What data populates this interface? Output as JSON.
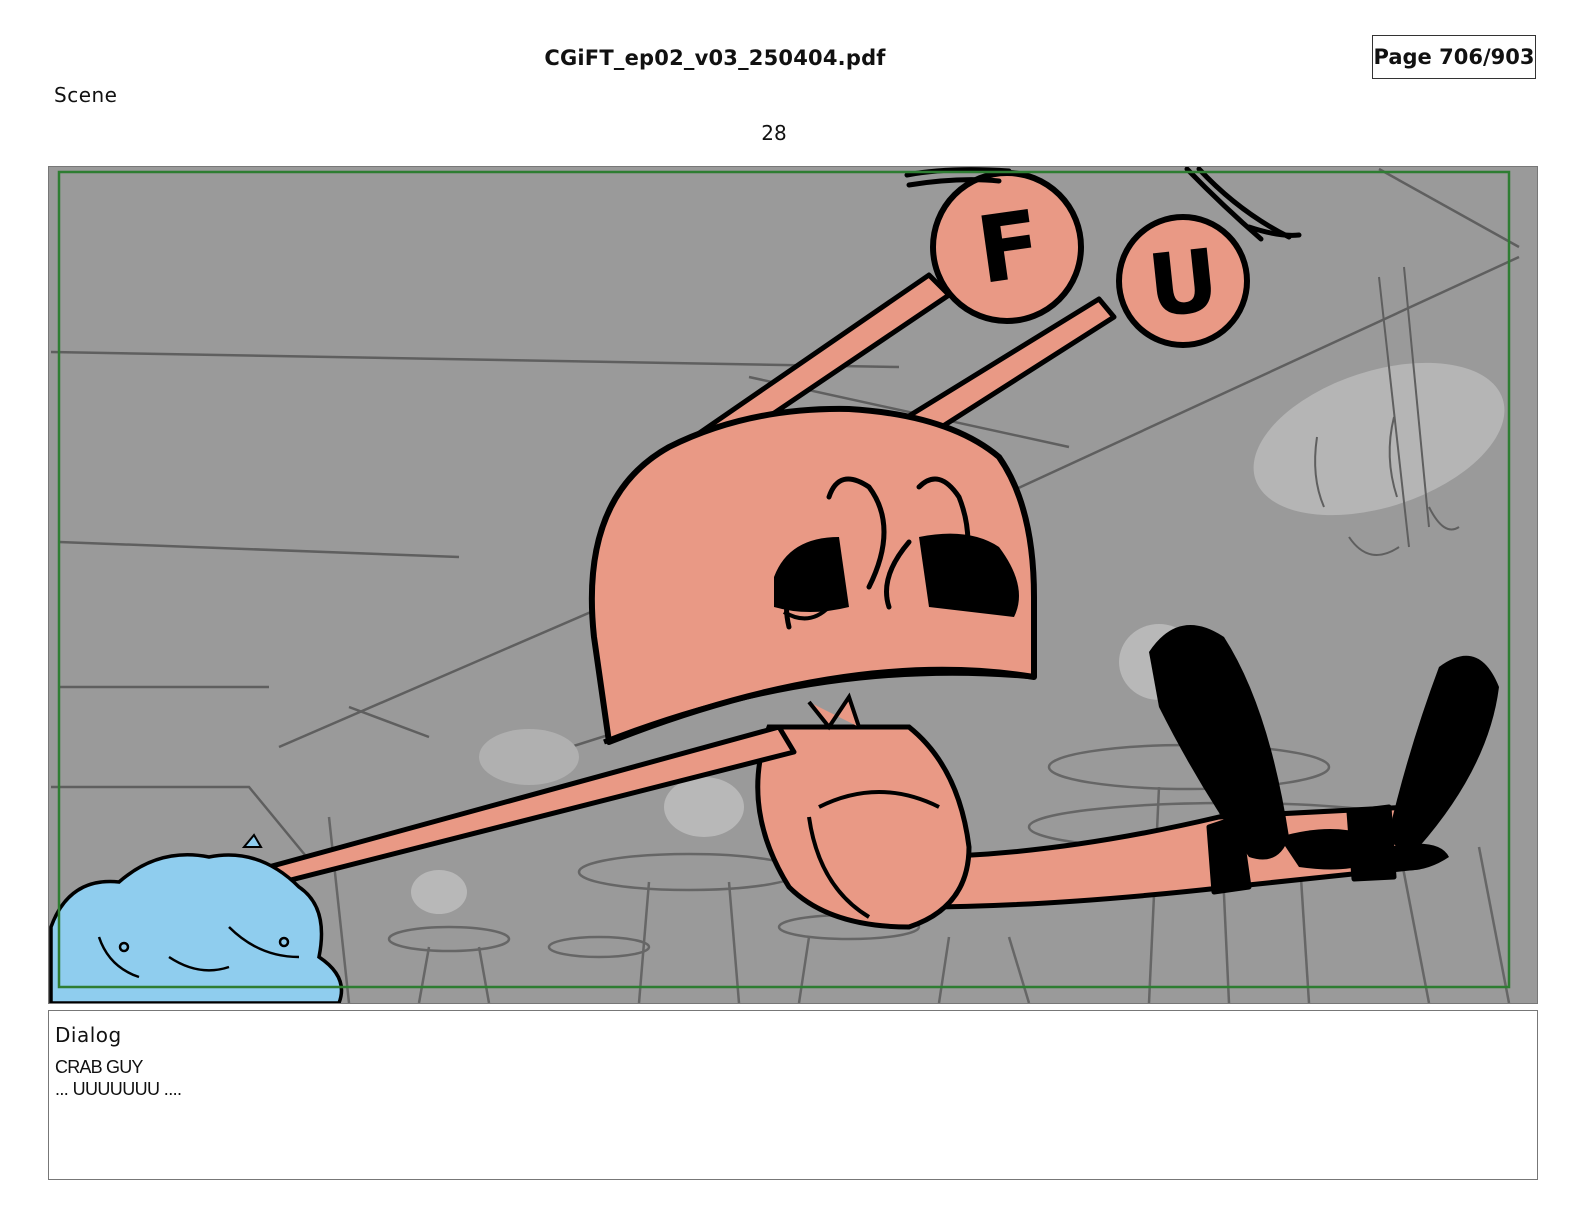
{
  "header": {
    "doc_title": "CGiFT_ep02_v03_250404.pdf",
    "page_indicator": "Page 706/903"
  },
  "scene": {
    "label": "Scene",
    "number": "28"
  },
  "panel": {
    "eye_letters": [
      "F",
      "U"
    ],
    "colors": {
      "background": "#9a9a9a",
      "crab_body": "#e99985",
      "blue_creature": "#8fcdee",
      "safe_frame": "#2e7d32",
      "ink": "#000000"
    }
  },
  "dialog": {
    "label": "Dialog",
    "speaker": "CRAB GUY",
    "line": "... UUUUUUU ...."
  }
}
